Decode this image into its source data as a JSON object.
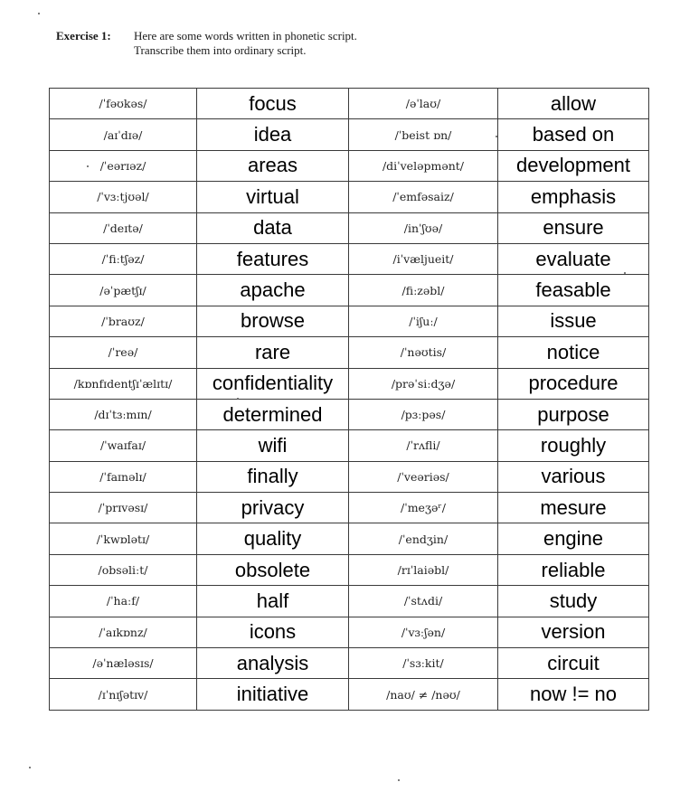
{
  "exercise": {
    "label": "Exercise 1:",
    "instruction_line1": "Here are some words written in phonetic script.",
    "instruction_line2": "Transcribe them into ordinary script."
  },
  "rows": [
    {
      "ph1": "/ˈfəʊkəs/",
      "w1": "focus",
      "ph2": "/əˈlaʊ/",
      "w2": "allow"
    },
    {
      "ph1": "/aɪˈdɪə/",
      "w1": "idea",
      "ph2": "/ˈbeist ɒn/",
      "w2": "based on"
    },
    {
      "ph1": "/ˈeərɪəz/",
      "w1": "areas",
      "ph2": "/diˈveləpmənt/",
      "w2": "development"
    },
    {
      "ph1": "/ˈvɜːtjʊəl/",
      "w1": "virtual",
      "ph2": "/ˈemfəsaiz/",
      "w2": "emphasis"
    },
    {
      "ph1": "/ˈdeɪtə/",
      "w1": "data",
      "ph2": "/inˈʃʊə/",
      "w2": "ensure"
    },
    {
      "ph1": "/ˈfiːtʃəz/",
      "w1": "features",
      "ph2": "/iˈvæljueit/",
      "w2": "evaluate"
    },
    {
      "ph1": "/əˈpætʃɪ/",
      "w1": "apache",
      "ph2": "/fiːzəbl/",
      "w2": "feasable"
    },
    {
      "ph1": "/ˈbraʊz/",
      "w1": "browse",
      "ph2": "/ˈiʃuː/",
      "w2": "issue"
    },
    {
      "ph1": "/ˈreə/",
      "w1": "rare",
      "ph2": "/ˈnəʊtis/",
      "w2": "notice"
    },
    {
      "ph1": "/kɒnfɪdentʃɪˈælɪtɪ/",
      "w1": "confidentiality",
      "ph2": "/prəˈsiːdʒə/",
      "w2": "procedure"
    },
    {
      "ph1": "/dɪˈtɜːmɪn/",
      "w1": "determined",
      "ph2": "/pɜːpəs/",
      "w2": "purpose"
    },
    {
      "ph1": "/ˈwaɪfaɪ/",
      "w1": "wifi",
      "ph2": "/ˈrʌfli/",
      "w2": "roughly"
    },
    {
      "ph1": "/ˈfaɪnəlɪ/",
      "w1": "finally",
      "ph2": "/ˈveəriəs/",
      "w2": "various"
    },
    {
      "ph1": "/ˈprɪvəsɪ/",
      "w1": "privacy",
      "ph2": "/ˈmeʒəʳ/",
      "w2": "mesure"
    },
    {
      "ph1": "/ˈkwɒlətɪ/",
      "w1": "quality",
      "ph2": "/ˈendʒin/",
      "w2": "engine"
    },
    {
      "ph1": "/obsəliːt/",
      "w1": "obsolete",
      "ph2": "/rɪˈlaiəbl/",
      "w2": "reliable"
    },
    {
      "ph1": "/ˈhaːf/",
      "w1": "half",
      "ph2": "/ˈstʌdi/",
      "w2": "study"
    },
    {
      "ph1": "/ˈaɪkɒnz/",
      "w1": "icons",
      "ph2": "/ˈvɜːʃən/",
      "w2": "version"
    },
    {
      "ph1": "/əˈnæləsɪs/",
      "w1": "analysis",
      "ph2": "/ˈsɜːkit/",
      "w2": "circuit"
    },
    {
      "ph1": "/ɪˈnɪʃətɪv/",
      "w1": "initiative",
      "ph2": "/naʊ/ ≠ /nəʊ/",
      "w2": "now != no"
    }
  ]
}
